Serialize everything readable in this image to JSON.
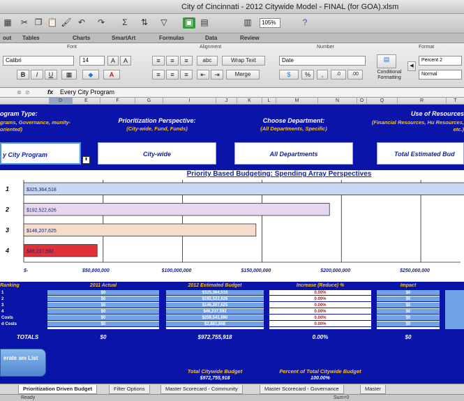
{
  "window": {
    "title": "City of Cincinnati - 2012 Citywide Model - FINAL (for GOA).xlsm"
  },
  "toolbar": {
    "zoom": "105%"
  },
  "ribbon_tabs": [
    "out",
    "Tables",
    "Charts",
    "SmartArt",
    "Formulas",
    "Data",
    "Review"
  ],
  "ribbon": {
    "font_group_label": "Font",
    "alignment_group_label": "Alignment",
    "number_group_label": "Number",
    "format_group_label": "Format",
    "font_name": "Calibri",
    "font_size": "14",
    "wrap_text_label": "Wrap Text",
    "merge_label": "Merge",
    "number_format": "Date",
    "percent_label": "%",
    "comma_label": ",",
    "conditional_formatting_label": "Conditional Formatting",
    "style_percent": "Percent 2",
    "style_normal": "Normal"
  },
  "formula_bar": {
    "fx": "fx",
    "value": "Every City Program"
  },
  "column_headers": [
    "D",
    "E",
    "F",
    "G",
    "I",
    "J",
    "K",
    "L",
    "M",
    "N",
    "O",
    "Q",
    "R",
    "T"
  ],
  "filters": {
    "program_type": {
      "label": "ogram Type:",
      "sub": "grams, Governance, munity-oriented)",
      "value": "y City Program"
    },
    "perspective": {
      "label": "Prioritization Perspective:",
      "sub": "(City-wide, Fund, Funds)",
      "value": "City-wide"
    },
    "department": {
      "label": "Choose Department:",
      "sub": "(All Departments, Specific)",
      "value": "All Departments"
    },
    "resources": {
      "label": "Use of Resources",
      "sub": "(Financial Resources, Hu Resources, etc.)",
      "value": "Total Estimated Bud"
    }
  },
  "chart_data": {
    "type": "bar",
    "orientation": "horizontal",
    "title": "Priority Based Budgeting: Spending Array Perspectives",
    "categories": [
      "1",
      "2",
      "3",
      "4"
    ],
    "values": [
      325364518,
      192522626,
      146207625,
      46237592
    ],
    "labels": [
      "$325,364,518",
      "$192,522,626",
      "$146,207,625",
      "$46,237,592"
    ],
    "colors": [
      "#c9d8f2",
      "#e6d6ef",
      "#f6dccb",
      "#e0303a"
    ],
    "xticks": [
      "$-",
      "$50,000,000",
      "$100,000,000",
      "$150,000,000",
      "$200,000,000",
      "$250,000,000"
    ],
    "xlim": [
      0,
      275000000
    ],
    "grid": true
  },
  "table": {
    "headers": [
      "Ranking",
      "2011 Actual",
      "2012 Estimated Budget",
      "Increase (Reduce) %",
      "Impact"
    ],
    "row_labels": [
      "1",
      "2",
      "3",
      "4",
      "Costs",
      "d Costs"
    ],
    "actual": [
      "$0",
      "$0",
      "$0",
      "$0",
      "$0",
      "$0"
    ],
    "estimated": [
      "$325,364,518",
      "$192,522,626",
      "$146,207,625",
      "$46,237,592",
      "$259,541,690",
      "$2,881,868"
    ],
    "increase": [
      "0.00%",
      "0.00%",
      "0.00%",
      "0.00%",
      "0.00%",
      "0.00%"
    ],
    "impact": [
      "$0",
      "$0",
      "$0",
      "$0",
      "$0",
      "$0"
    ],
    "row_label_prefix": [
      "1",
      "2",
      "3",
      "4",
      "Costs",
      "d Costs"
    ],
    "totals_label": "TOTALS",
    "totals": {
      "actual": "$0",
      "estimated": "$972,755,918",
      "increase": "0.00%",
      "impact": "$0"
    }
  },
  "generate_button": {
    "label": "erate am List"
  },
  "footer": {
    "total_budget_label": "Total Citywide Budget",
    "total_budget_value": "$972,755,918",
    "percent_label": "Percent of Total Citywide Budget",
    "percent_value": "100.00%"
  },
  "sheet_tabs": [
    "Prioritization Driven Budget",
    "Filter Options",
    "Master Scorecard - Community",
    "Master Scorecard - Governance",
    "Master"
  ],
  "status": {
    "ready": "Ready",
    "sum": "Sum=0"
  }
}
